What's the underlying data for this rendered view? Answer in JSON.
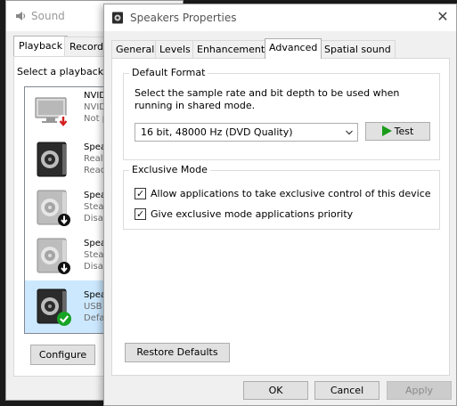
{
  "sound_window": {
    "title": "Sound",
    "tabs": [
      "Playback",
      "Recording"
    ],
    "caption": "Select a playback",
    "devices": [
      {
        "name": "NVID",
        "line2": "NVID",
        "line3": "Not p",
        "type": "monitor",
        "badge": "arrow-down-red"
      },
      {
        "name": "Spea",
        "line2": "Realt",
        "line3": "Read",
        "type": "speaker",
        "badge": "none"
      },
      {
        "name": "Spea",
        "line2": "Stea",
        "line3": "Disa",
        "type": "speaker",
        "badge": "arrow-down"
      },
      {
        "name": "Spea",
        "line2": "Stea",
        "line3": "Disa",
        "type": "speaker",
        "badge": "arrow-down"
      },
      {
        "name": "Spea",
        "line2": "USB",
        "line3": "Defa",
        "type": "speaker",
        "badge": "check-green"
      }
    ],
    "configure_label": "Configure"
  },
  "dialog": {
    "title": "Speakers Properties",
    "close_glyph": "✕",
    "tabs": [
      {
        "label": "General",
        "active": false
      },
      {
        "label": "Levels",
        "active": false
      },
      {
        "label": "Enhancements",
        "active": false
      },
      {
        "label": "Advanced",
        "active": true
      },
      {
        "label": "Spatial sound",
        "active": false
      }
    ],
    "default_format": {
      "legend": "Default Format",
      "description": "Select the sample rate and bit depth to be used when running in shared mode.",
      "selected_format": "16 bit, 48000 Hz (DVD Quality)",
      "test_label": "Test"
    },
    "exclusive_mode": {
      "legend": "Exclusive Mode",
      "options": [
        {
          "label": "Allow applications to take exclusive control of this device",
          "checked": true
        },
        {
          "label": "Give exclusive mode applications priority",
          "checked": true
        }
      ]
    },
    "restore_label": "Restore Defaults",
    "buttons": {
      "ok": "OK",
      "cancel": "Cancel",
      "apply": "Apply"
    }
  },
  "colors": {
    "accent_selected": "#cce8ff",
    "play_green": "#1a9c1a",
    "check_green": "#17a324",
    "arrow_red": "#d31f1f"
  }
}
